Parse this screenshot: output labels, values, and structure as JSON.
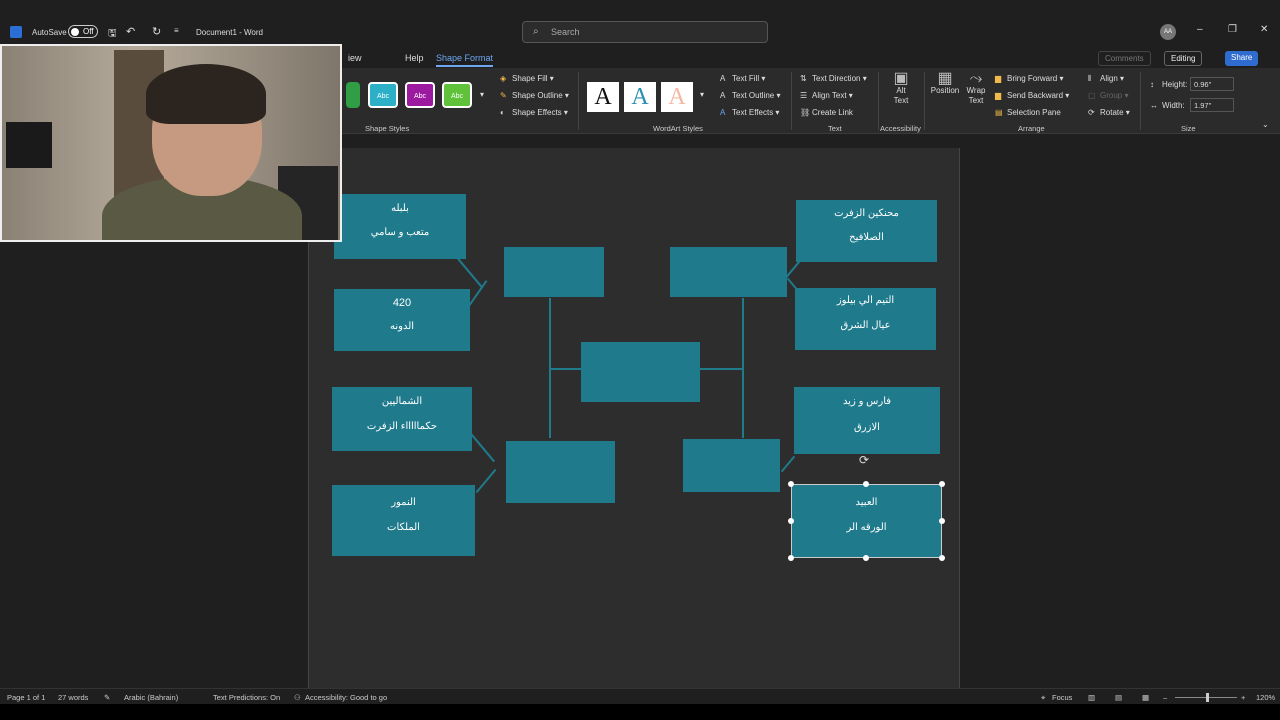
{
  "titlebar": {
    "autosave_label": "AutoSave",
    "autosave_state": "Off",
    "doc_title": "Document1 - Word",
    "search_placeholder": "Search",
    "avatar_initials": "AA"
  },
  "tabs": {
    "view": "iew",
    "help": "Help",
    "shape_format": "Shape Format",
    "comments": "Comments",
    "editing": "Editing",
    "share": "Share"
  },
  "ribbon": {
    "shape_styles_label": "Shape Styles",
    "swatch_label": "Abc",
    "swatch_colors": [
      "#2f9e44",
      "#2bb0c8",
      "#9c1aa0",
      "#5fc23a"
    ],
    "shape_fill": "Shape Fill",
    "shape_outline": "Shape Outline",
    "shape_effects": "Shape Effects",
    "wordart_label": "WordArt Styles",
    "wordart_letter": "A",
    "text_fill": "Text Fill",
    "text_outline": "Text Outline",
    "text_effects": "Text Effects",
    "text_direction": "Text Direction",
    "align_text": "Align Text",
    "create_link": "Create Link",
    "text_label": "Text",
    "alt_text_1": "Alt",
    "alt_text_2": "Text",
    "accessibility_label": "Accessibility",
    "position": "Position",
    "wrap_text_1": "Wrap",
    "wrap_text_2": "Text",
    "bring_forward": "Bring Forward",
    "send_backward": "Send Backward",
    "selection_pane": "Selection Pane",
    "align": "Align",
    "group": "Group",
    "rotate": "Rotate",
    "arrange_label": "Arrange",
    "height_label": "Height:",
    "height_value": "0.96\"",
    "width_label": "Width:",
    "width_value": "1.97\"",
    "size_label": "Size"
  },
  "diagram": {
    "left_boxes": [
      {
        "line1": "بلبله",
        "line2": "متعب و سامي"
      },
      {
        "line1": "420",
        "line2": "الدونه"
      },
      {
        "line1": "الشماليين",
        "line2": "حكماااااء الزفرت"
      },
      {
        "line1": "النمور",
        "line2": "الملكات"
      }
    ],
    "right_boxes": [
      {
        "line1": "محنكين الزفرت",
        "line2": "الصلافيح"
      },
      {
        "line1": "التيم الي بيلوز",
        "line2": "عيال الشرق"
      },
      {
        "line1": "فارس و زيد",
        "line2": "الازرق"
      },
      {
        "line1": "العبيد",
        "line2": "الورقه الر"
      }
    ]
  },
  "statusbar": {
    "page": "Page 1 of 1",
    "words": "27 words",
    "language": "Arabic (Bahrain)",
    "predictions": "Text Predictions: On",
    "accessibility": "Accessibility: Good to go",
    "focus": "Focus",
    "zoom": "120%"
  }
}
